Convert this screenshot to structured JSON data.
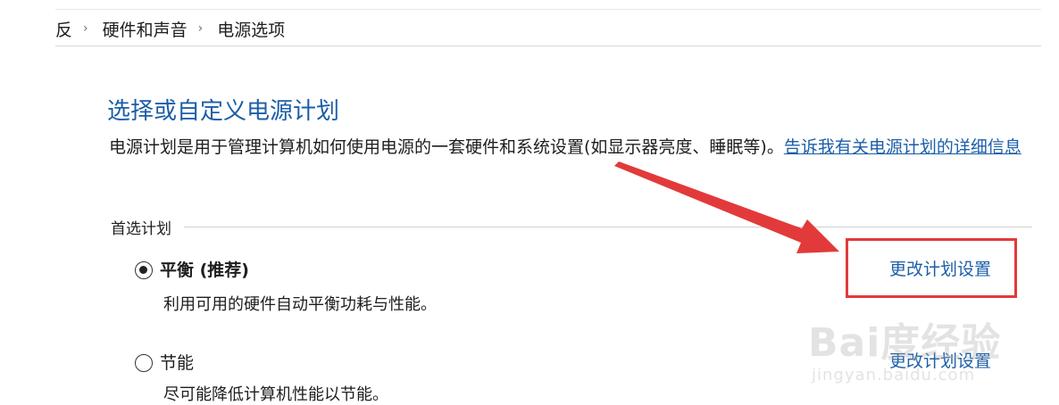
{
  "breadcrumb": {
    "items": [
      "反",
      "硬件和声音",
      "电源选项"
    ]
  },
  "main": {
    "title": "选择或自定义电源计划",
    "description": "电源计划是用于管理计算机如何使用电源的一套硬件和系统设置(如显示器亮度、睡眠等)。",
    "learn_more_link": "告诉我有关电源计划的详细信息",
    "section_label": "首选计划"
  },
  "plans": [
    {
      "name": "平衡 (推荐)",
      "description": "利用可用的硬件自动平衡功耗与性能。",
      "selected": true,
      "action_link": "更改计划设置"
    },
    {
      "name": "节能",
      "description": "尽可能降低计算机性能以节能。",
      "selected": false,
      "action_link": "更改计划设置"
    }
  ],
  "annotation": {
    "arrow_color": "#e23a3a",
    "box_color": "#e23a3a"
  },
  "watermark": {
    "text": "Bai度经验",
    "sub": "jingyan.baidu.com"
  },
  "colors": {
    "link": "#1c5ea8",
    "title": "#1c5ea8"
  }
}
